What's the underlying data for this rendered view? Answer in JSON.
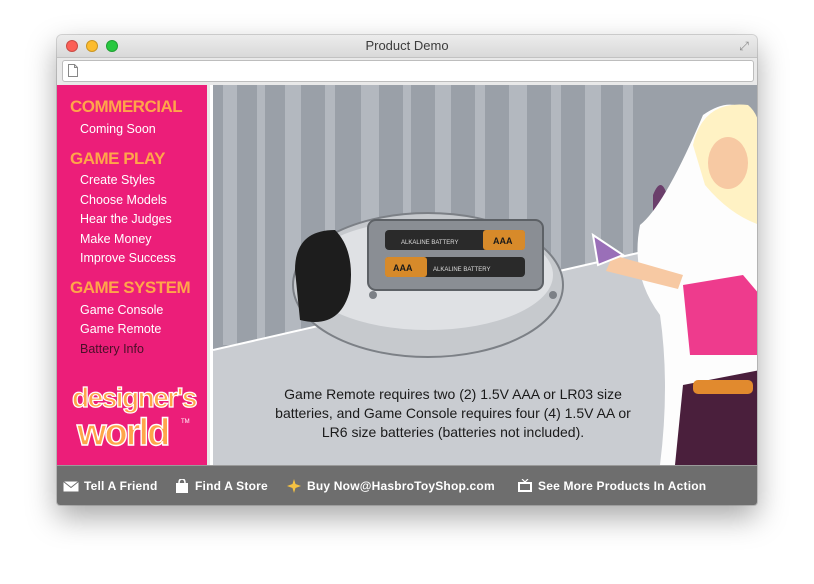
{
  "window": {
    "title": "Product Demo"
  },
  "sidebar": {
    "sections": [
      {
        "heading": "COMMERCIAL",
        "items": [
          "Coming Soon"
        ]
      },
      {
        "heading": "GAME PLAY",
        "items": [
          "Create Styles",
          "Choose Models",
          "Hear the Judges",
          "Make Money",
          "Improve Success"
        ]
      },
      {
        "heading": "GAME SYSTEM",
        "items": [
          "Game Console",
          "Game Remote",
          "Battery Info"
        ]
      }
    ],
    "active_item": "Battery Info",
    "logo_line1": "designer's",
    "logo_line2": "world",
    "logo_tm": "TM"
  },
  "main": {
    "battery_text": "Game Remote requires two (2) 1.5V AAA or LR03 size batteries, and Game Console requires four (4) 1.5V AA or LR6 size batteries (batteries not included).",
    "battery_label_1": "ALKALINE BATTERY",
    "battery_label_2": "AAA",
    "battery_label_3": "ALKALINE BATTERY",
    "battery_label_4": "AAA"
  },
  "footer": {
    "links": [
      "Tell A Friend",
      "Find A Store",
      "Buy Now@HasbroToyShop.com",
      "See More Products In Action"
    ]
  },
  "colors": {
    "sidebar_bg": "#ec1e79",
    "heading": "#ffa54a",
    "footer_bg": "#6e6e6e"
  }
}
